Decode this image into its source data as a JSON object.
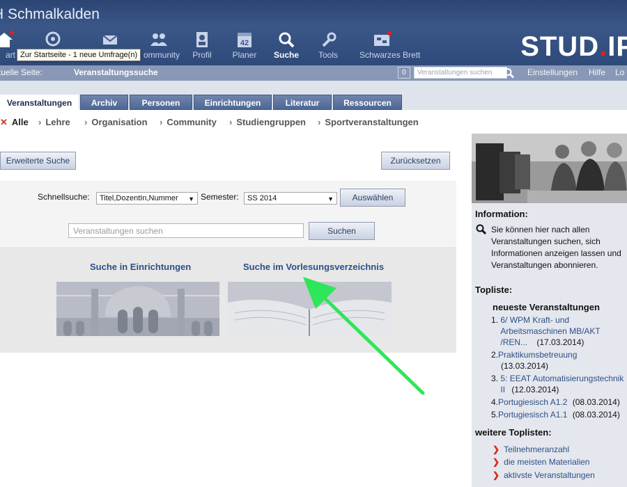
{
  "header": {
    "site_title": "H Schmalkalden",
    "logo_main": "STUD",
    "logo_dot": ".",
    "logo_tail": "IP",
    "nav": [
      {
        "label": "art",
        "icon": "home-icon"
      },
      {
        "label": "",
        "icon": "community-ring-icon"
      },
      {
        "label": "",
        "icon": "mail-icon"
      },
      {
        "label": "ommunity",
        "icon": "people-icon"
      },
      {
        "label": "Profil",
        "icon": "profile-icon"
      },
      {
        "label": "Planer",
        "icon": "calendar-icon",
        "badge": "42"
      },
      {
        "label": "Suche",
        "icon": "search-icon",
        "active": true
      },
      {
        "label": "Tools",
        "icon": "wrench-icon"
      },
      {
        "label": "Schwarzes Brett",
        "icon": "board-icon"
      }
    ],
    "tooltip": "Zur Startseite - 1 neue Umfrage(n)"
  },
  "location": {
    "label": "tuelle Seite:",
    "value": "Veranstaltungssuche",
    "count": "0",
    "search_placeholder": "Veranstaltungen suchen",
    "links": [
      "Einstellungen",
      "Hilfe",
      "Lo"
    ]
  },
  "tabs": [
    "Veranstaltungen",
    "Archiv",
    "Personen",
    "Einrichtungen",
    "Literatur",
    "Ressourcen"
  ],
  "subnav": [
    "Alle",
    "Lehre",
    "Organisation",
    "Community",
    "Studiengruppen",
    "Sportveranstaltungen"
  ],
  "actions": {
    "advanced": "Erweiterte Suche",
    "reset": "Zurücksetzen"
  },
  "quicksearch": {
    "label": "Schnellsuche:",
    "field_value": "Titel,DozentIn,Nummer",
    "semester_label": "Semester:",
    "semester_value": "SS 2014",
    "select_button": "Auswählen",
    "input_placeholder": "Veranstaltungen suchen",
    "search_button": "Suchen"
  },
  "browse": {
    "institutions": "Suche in Einrichtungen",
    "catalog": "Suche im Vorlesungsverzeichnis"
  },
  "sidebar": {
    "info_heading": "Information:",
    "info_text": "Sie können hier nach allen Veranstaltungen suchen, sich Informationen anzeigen lassen und Veranstaltungen abonnieren.",
    "top_heading": "Topliste:",
    "newest_heading": "neueste Veranstaltungen",
    "newest": [
      {
        "num": "1.",
        "title": "6/ WPM Kraft- und Arbeitsmaschinen MB/AKT /REN...",
        "date": "(17.03.2014)"
      },
      {
        "num": "2.",
        "title": "Praktikumsbetreuung",
        "date": "(13.03.2014)"
      },
      {
        "num": "3.",
        "title": "5: EEAT Automatisierungstechnik II",
        "date": "(12.03.2014)"
      },
      {
        "num": "4.",
        "title": "Portugiesisch A1.2",
        "date": "(08.03.2014)"
      },
      {
        "num": "5.",
        "title": "Portugiesisch A1.1",
        "date": "(08.03.2014)"
      }
    ],
    "more_heading": "weitere Toplisten:",
    "more": [
      "Teilnehmeranzahl",
      "die meisten Materialien",
      "aktivste Veranstaltungen"
    ]
  },
  "colors": {
    "header": "#3b5787",
    "accent_red": "#e3201b",
    "link": "#2d4f85",
    "arrow": "#2ee65a"
  }
}
